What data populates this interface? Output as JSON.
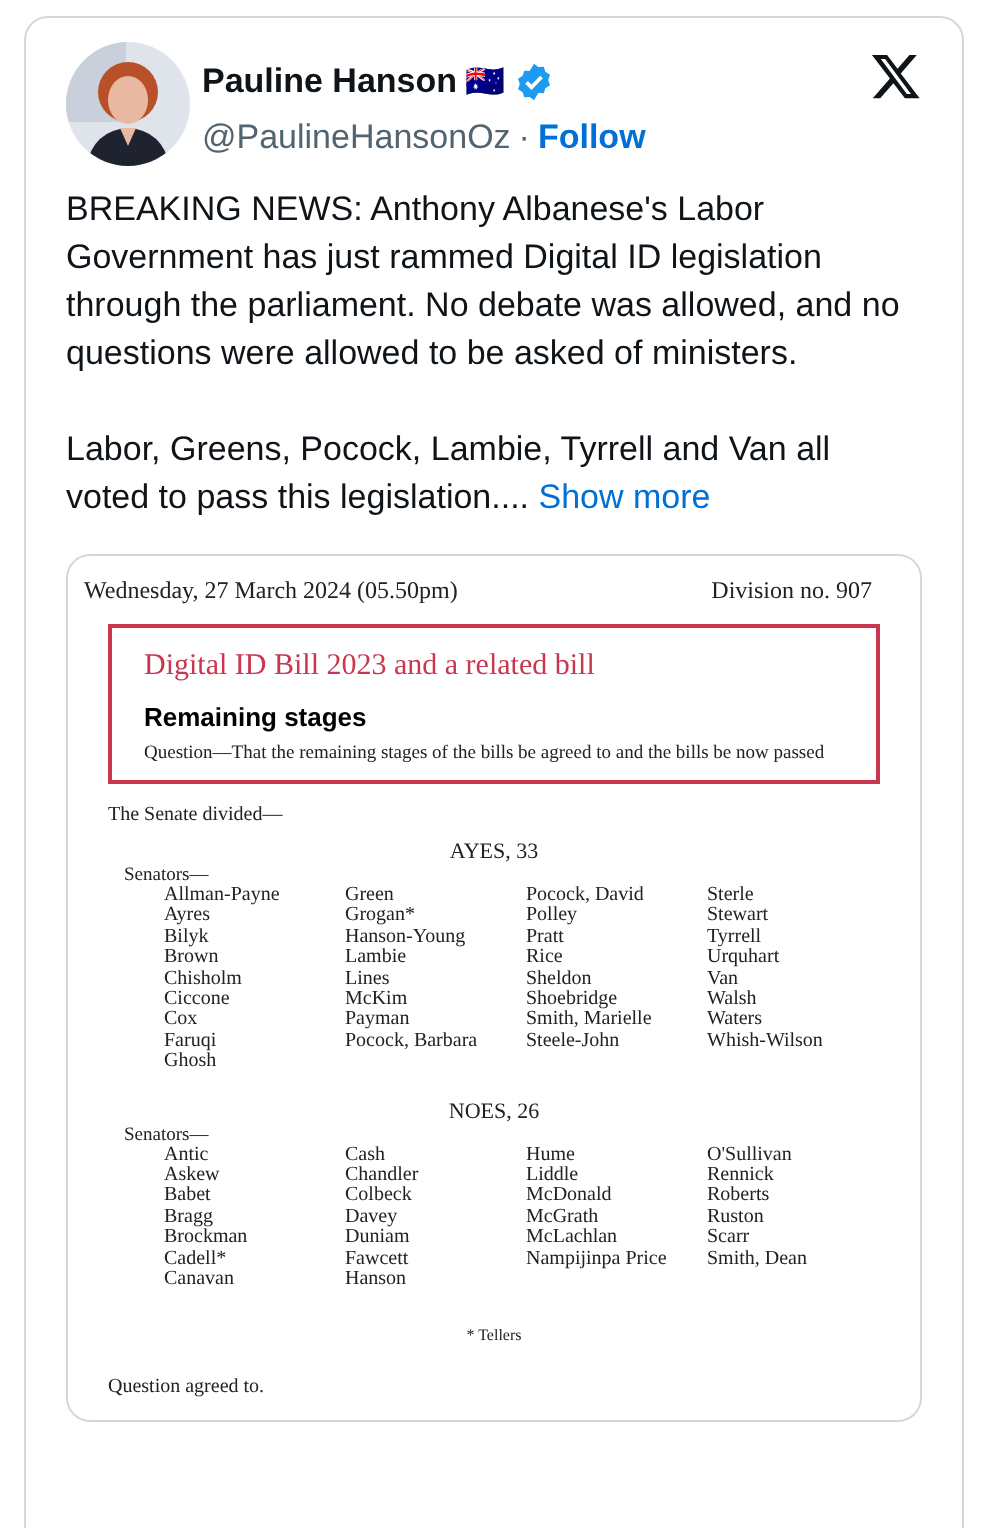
{
  "author": {
    "name": "Pauline Hanson",
    "flag": "🇦🇺",
    "verified": true,
    "handle": "@PaulineHansonOz",
    "separator": "·",
    "follow": "Follow"
  },
  "paragraphs": [
    "BREAKING NEWS: Anthony Albanese's Labor Government has just rammed Digital ID legislation through the parliament. No debate was allowed, and no questions were allowed to be asked of ministers.",
    "Labor, Greens, Pocock, Lambie, Tyrrell and Van all voted to pass this legislation...."
  ],
  "show_more": "Show more",
  "document": {
    "date": "Wednesday, 27 March 2024 (05.50pm)",
    "division": "Division no. 907",
    "bill_title": "Digital ID Bill 2023 and a related bill",
    "stage": "Remaining stages",
    "question": "Question—That the remaining stages of the bills be agreed to and the bills be now passed",
    "intro": "The Senate divided—",
    "votes": [
      {
        "heading": "AYES, 33",
        "group_label": "Senators—",
        "columns": [
          [
            "Allman-Payne",
            "Ayres",
            "Bilyk",
            "Brown",
            "Chisholm",
            "Ciccone",
            "Cox",
            "Faruqi",
            "Ghosh"
          ],
          [
            "Green",
            "Grogan*",
            "Hanson-Young",
            "Lambie",
            "Lines",
            "McKim",
            "Payman",
            "Pocock, Barbara"
          ],
          [
            "Pocock, David",
            "Polley",
            "Pratt",
            "Rice",
            "Sheldon",
            "Shoebridge",
            "Smith, Marielle",
            "Steele-John"
          ],
          [
            "Sterle",
            "Stewart",
            "Tyrrell",
            "Urquhart",
            "Van",
            "Walsh",
            "Waters",
            "Whish-Wilson"
          ]
        ]
      },
      {
        "heading": "NOES, 26",
        "group_label": "Senators—",
        "columns": [
          [
            "Antic",
            "Askew",
            "Babet",
            "Bragg",
            "Brockman",
            "Cadell*",
            "Canavan"
          ],
          [
            "Cash",
            "Chandler",
            "Colbeck",
            "Davey",
            "Duniam",
            "Fawcett",
            "Hanson"
          ],
          [
            "Hume",
            "Liddle",
            "McDonald",
            "McGrath",
            "McLachlan",
            "Nampijinpa Price"
          ],
          [
            "O'Sullivan",
            "Rennick",
            "Roberts",
            "Ruston",
            "Scarr",
            "Smith, Dean"
          ]
        ]
      }
    ],
    "note": "* Tellers",
    "result": "Question agreed to."
  }
}
